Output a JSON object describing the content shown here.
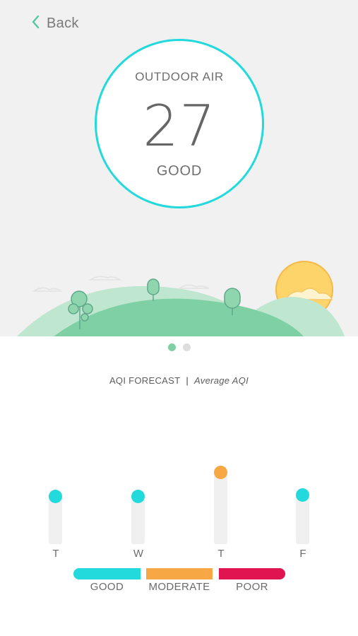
{
  "nav": {
    "back_label": "Back"
  },
  "air": {
    "title": "OUTDOOR AIR",
    "value": "27",
    "status": "GOOD"
  },
  "pager": {
    "pages": 2,
    "active": 0
  },
  "forecast": {
    "header": "AQI FORECAST",
    "separator": "|",
    "subheader": "Average AQI",
    "days": [
      {
        "label": "T",
        "level": "good"
      },
      {
        "label": "W",
        "level": "good"
      },
      {
        "label": "T",
        "level": "moderate"
      },
      {
        "label": "F",
        "level": "good"
      }
    ]
  },
  "legend": [
    {
      "label": "GOOD",
      "color": "#22d9dc"
    },
    {
      "label": "MODERATE",
      "color": "#f7a845"
    },
    {
      "label": "POOR",
      "color": "#e0144f"
    }
  ],
  "colors": {
    "accent": "#22d9dc",
    "good": "#22d9dc",
    "moderate": "#f7a845",
    "poor": "#e0144f",
    "hill": "#7fd0a5",
    "sun": "#fcd46a"
  }
}
